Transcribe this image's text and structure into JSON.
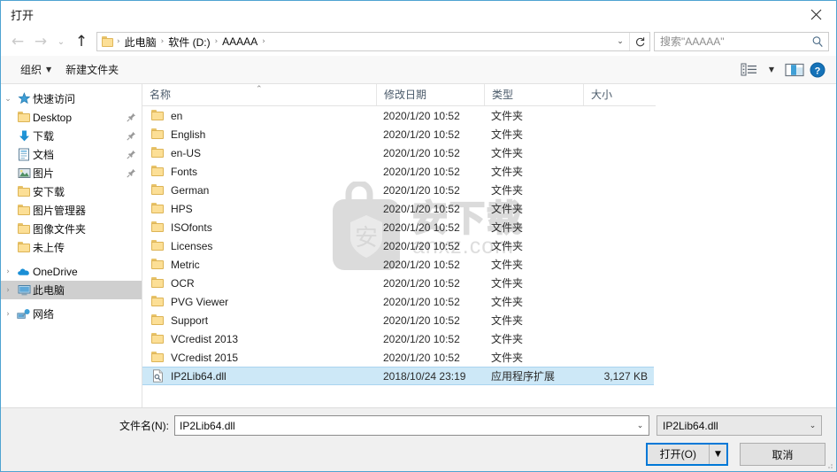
{
  "window": {
    "title": "打开",
    "close_label": "✕"
  },
  "nav": {
    "back_icon": "←",
    "forward_icon": "→",
    "recent_icon": "⌄",
    "up_icon": "↑",
    "refresh_icon": "↻",
    "address_dropdown_icon": "⌄",
    "breadcrumbs": [
      {
        "label": "此电脑"
      },
      {
        "label": "软件 (D:)"
      },
      {
        "label": "AAAAA"
      }
    ],
    "separator": "›"
  },
  "search": {
    "placeholder": "搜索\"AAAAA\"",
    "value": "",
    "icon": "search-icon"
  },
  "toolbar": {
    "organize_label": "组织",
    "organize_caret": "▼",
    "new_folder_label": "新建文件夹",
    "view_caret": "▼",
    "icons": [
      "view-list-icon",
      "preview-pane-icon",
      "help-icon"
    ],
    "help_label": "?"
  },
  "sidebar": {
    "items": [
      {
        "label": "快速访问",
        "icon": "star-icon",
        "expander": "⌄",
        "indent": 0,
        "pinned": false,
        "selected": false
      },
      {
        "label": "Desktop",
        "icon": "folder-icon",
        "expander": "",
        "indent": 1,
        "pinned": true,
        "selected": false
      },
      {
        "label": "下载",
        "icon": "download-icon",
        "expander": "",
        "indent": 1,
        "pinned": true,
        "selected": false
      },
      {
        "label": "文档",
        "icon": "documents-icon",
        "expander": "",
        "indent": 1,
        "pinned": true,
        "selected": false
      },
      {
        "label": "图片",
        "icon": "pictures-icon",
        "expander": "",
        "indent": 1,
        "pinned": true,
        "selected": false
      },
      {
        "label": "安下载",
        "icon": "folder-icon",
        "expander": "",
        "indent": 1,
        "pinned": false,
        "selected": false
      },
      {
        "label": "图片管理器",
        "icon": "folder-icon",
        "expander": "",
        "indent": 1,
        "pinned": false,
        "selected": false
      },
      {
        "label": "图像文件夹",
        "icon": "folder-icon",
        "expander": "",
        "indent": 1,
        "pinned": false,
        "selected": false
      },
      {
        "label": "未上传",
        "icon": "folder-icon",
        "expander": "",
        "indent": 1,
        "pinned": false,
        "selected": false
      },
      {
        "label": "OneDrive",
        "icon": "onedrive-icon",
        "expander": "›",
        "indent": 0,
        "pinned": false,
        "selected": false
      },
      {
        "label": "此电脑",
        "icon": "this-pc-icon",
        "expander": "›",
        "indent": 0,
        "pinned": false,
        "selected": true
      },
      {
        "label": "网络",
        "icon": "network-icon",
        "expander": "›",
        "indent": 0,
        "pinned": false,
        "selected": false
      }
    ]
  },
  "filelist": {
    "columns": [
      "名称",
      "修改日期",
      "类型",
      "大小"
    ],
    "sort_caret": "⌃",
    "folder_type": "文件夹",
    "rows": [
      {
        "name": "en",
        "date": "2020/1/20 10:52",
        "type": "文件夹",
        "size": "",
        "icon": "folder-icon",
        "selected": false
      },
      {
        "name": "English",
        "date": "2020/1/20 10:52",
        "type": "文件夹",
        "size": "",
        "icon": "folder-icon",
        "selected": false
      },
      {
        "name": "en-US",
        "date": "2020/1/20 10:52",
        "type": "文件夹",
        "size": "",
        "icon": "folder-icon",
        "selected": false
      },
      {
        "name": "Fonts",
        "date": "2020/1/20 10:52",
        "type": "文件夹",
        "size": "",
        "icon": "folder-icon",
        "selected": false
      },
      {
        "name": "German",
        "date": "2020/1/20 10:52",
        "type": "文件夹",
        "size": "",
        "icon": "folder-icon",
        "selected": false
      },
      {
        "name": "HPS",
        "date": "2020/1/20 10:52",
        "type": "文件夹",
        "size": "",
        "icon": "folder-icon",
        "selected": false
      },
      {
        "name": "ISOfonts",
        "date": "2020/1/20 10:52",
        "type": "文件夹",
        "size": "",
        "icon": "folder-icon",
        "selected": false
      },
      {
        "name": "Licenses",
        "date": "2020/1/20 10:52",
        "type": "文件夹",
        "size": "",
        "icon": "folder-icon",
        "selected": false
      },
      {
        "name": "Metric",
        "date": "2020/1/20 10:52",
        "type": "文件夹",
        "size": "",
        "icon": "folder-icon",
        "selected": false
      },
      {
        "name": "OCR",
        "date": "2020/1/20 10:52",
        "type": "文件夹",
        "size": "",
        "icon": "folder-icon",
        "selected": false
      },
      {
        "name": "PVG Viewer",
        "date": "2020/1/20 10:52",
        "type": "文件夹",
        "size": "",
        "icon": "folder-icon",
        "selected": false
      },
      {
        "name": "Support",
        "date": "2020/1/20 10:52",
        "type": "文件夹",
        "size": "",
        "icon": "folder-icon",
        "selected": false
      },
      {
        "name": "VCredist 2013",
        "date": "2020/1/20 10:52",
        "type": "文件夹",
        "size": "",
        "icon": "folder-icon",
        "selected": false
      },
      {
        "name": "VCredist 2015",
        "date": "2020/1/20 10:52",
        "type": "文件夹",
        "size": "",
        "icon": "folder-icon",
        "selected": false
      },
      {
        "name": "IP2Lib64.dll",
        "date": "2018/10/24 23:19",
        "type": "应用程序扩展",
        "size": "3,127 KB",
        "icon": "dll-icon",
        "selected": true
      }
    ]
  },
  "watermark": {
    "cn_text": "安下载",
    "url_text": "anxz.com"
  },
  "footer": {
    "filename_label": "文件名(N):",
    "filename_value": "IP2Lib64.dll",
    "filename_placeholder": "",
    "filename_dropdown_icon": "⌄",
    "filter_value": "IP2Lib64.dll",
    "filter_dropdown_icon": "⌄",
    "open_label": "打开(O)",
    "open_split_icon": "▼",
    "cancel_label": "取消"
  },
  "colors": {
    "accent": "#0078d7",
    "selection": "#cde8f7",
    "window_border": "#4fa3d1",
    "folder_yellow": "#fcdf96"
  }
}
